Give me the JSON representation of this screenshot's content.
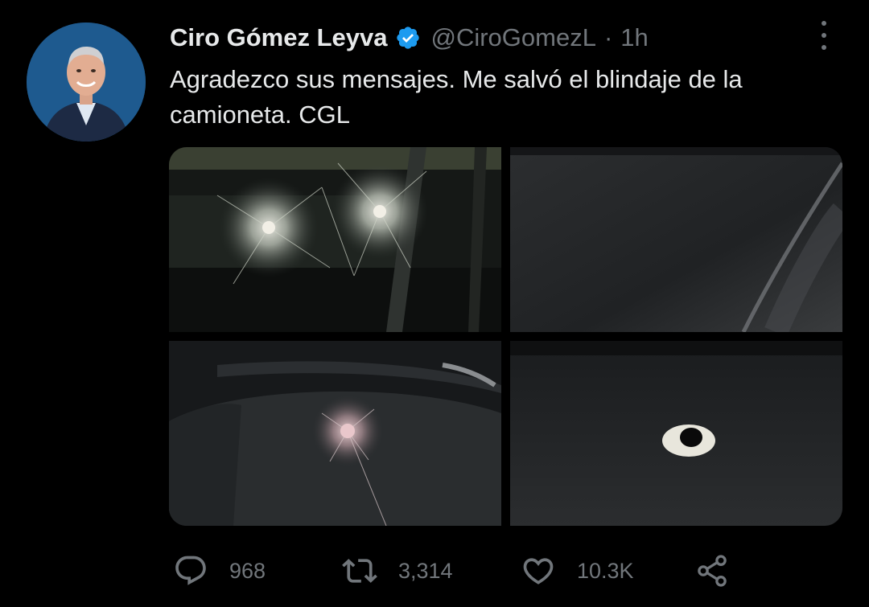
{
  "author": {
    "name": "Ciro Gómez Leyva",
    "handle": "@CiroGomezL",
    "separator": "·",
    "time": "1h",
    "verified": true
  },
  "tweet": {
    "text": "Agradezco sus mensajes. Me salvó el blindaje de la camioneta. CGL"
  },
  "media": {
    "photos": [
      {
        "icon": "shattered-windshield-photo"
      },
      {
        "icon": "dark-vehicle-surface-photo"
      },
      {
        "icon": "bullet-impact-glass-photo"
      },
      {
        "icon": "bullet-hole-metal-photo"
      }
    ]
  },
  "actions": {
    "replies": "968",
    "retweets": "3,314",
    "likes": "10.3K"
  },
  "colors": {
    "background": "#000000",
    "text": "#e7e9ea",
    "secondary": "#71767b",
    "verified": "#1d9bf0"
  },
  "icons": {
    "reply": "reply-icon",
    "retweet": "retweet-icon",
    "like": "heart-icon",
    "share": "share-icon",
    "more": "more-icon",
    "verified": "verified-badge-icon"
  }
}
